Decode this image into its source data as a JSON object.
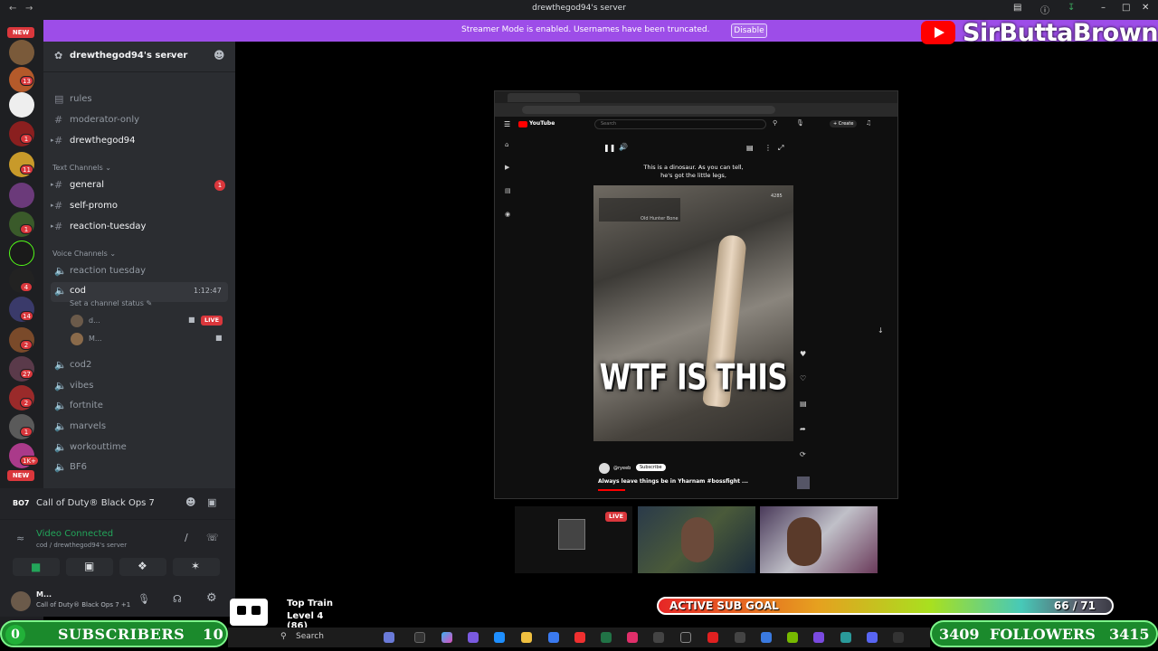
{
  "window": {
    "title": "drewthegod94's server"
  },
  "banner": {
    "message": "Streamer Mode is enabled. Usernames have been truncated.",
    "disable_label": "Disable"
  },
  "branding": {
    "channel_name": "SirButtaBrown",
    "youtube_icon": "youtube-play-icon"
  },
  "rail": {
    "new_label": "NEW",
    "badges": [
      "13",
      "1",
      "11",
      "1",
      "4",
      "14",
      "2",
      "27",
      "2",
      "1",
      "1K+",
      "1"
    ],
    "new_label_bottom": "NEW"
  },
  "server": {
    "name": "drewthegod94's server"
  },
  "channels": {
    "top": [
      {
        "name": "rules",
        "icon": "rules-icon"
      },
      {
        "name": "moderator-only",
        "icon": "hash-icon"
      },
      {
        "name": "drewthegod94",
        "icon": "hash-icon"
      }
    ],
    "text_category": "Text Channels",
    "text": [
      {
        "name": "general",
        "badge": "1"
      },
      {
        "name": "self-promo"
      },
      {
        "name": "reaction-tuesday"
      }
    ],
    "voice_category": "Voice Channels",
    "voice_first": "reaction tuesday",
    "active_voice": {
      "name": "cod",
      "timer": "1:12:47",
      "status": "Set a channel status",
      "users": [
        {
          "name": "d...",
          "live_label": "LIVE"
        },
        {
          "name": "M..."
        }
      ]
    },
    "voice_rest": [
      "cod2",
      "vibes",
      "fortnite",
      "marvels",
      "workouttime",
      "BF6"
    ]
  },
  "game_activity": {
    "name": "Call of Duty® Black Ops 7"
  },
  "voice_panel": {
    "status": "Video Connected",
    "location": "cod / drewthegod94's server"
  },
  "user_panel": {
    "name": "M...",
    "activity": "Call of Duty® Black Ops 7 +1"
  },
  "video": {
    "platform": "YouTube",
    "search_placeholder": "Search",
    "create_label": "+ Create",
    "caption_line1": "This is a dinosaur. As you can tell,",
    "caption_line2": "he's got the little legs,",
    "overlay_text": "WTF IS THIS",
    "hud_name": "Old Hunter Bone",
    "hud_number": "4285",
    "subscribe_label": "Subscribe",
    "title": "Always leave things be in Yharnam #bossfight ...",
    "channel_handle": "@ryeeb"
  },
  "webcams": {
    "live_label": "LIVE"
  },
  "overlays": {
    "subscribers_label": "SUBSCRIBERS",
    "subscribers_current": "0",
    "subscribers_goal": "10",
    "followers_label": "FOLLOWERS",
    "followers_current": "3409",
    "followers_goal": "3415",
    "sub_goal_label": "ACTIVE SUB GOAL",
    "sub_goal_value": "66 / 71",
    "sub_goal_fraction": 0.93,
    "top_train_title": "Top Train",
    "top_train_level": "Level 4  (86)"
  },
  "taskbar": {
    "search_placeholder": "Search"
  }
}
